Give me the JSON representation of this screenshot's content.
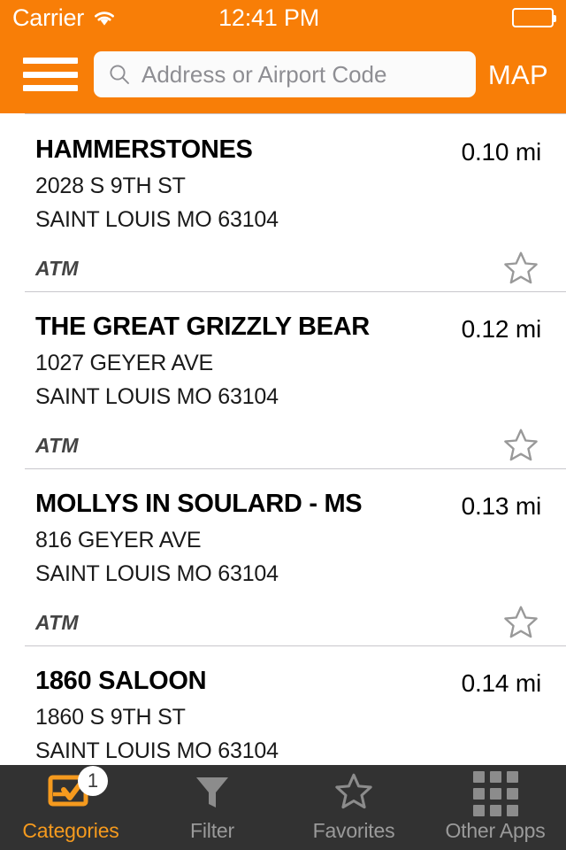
{
  "colors": {
    "brand_orange": "#f87e07",
    "tab_active_orange": "#f59a1e",
    "tab_bar_background": "#323232",
    "tab_inactive_gray": "#9a9a9a",
    "separator_gray": "#c8c7cc",
    "star_outline_gray": "#999999"
  },
  "status_bar": {
    "carrier": "Carrier",
    "wifi_icon": "wifi-icon",
    "time": "12:41 PM",
    "battery_icon": "battery-icon"
  },
  "nav_bar": {
    "menu_icon": "hamburger-menu-icon",
    "search": {
      "icon": "search-icon",
      "value": "",
      "placeholder": "Address or Airport Code"
    },
    "map_label": "MAP"
  },
  "list": {
    "items": [
      {
        "name": "HAMMERSTONES",
        "address_line1": "2028 S 9TH ST",
        "address_line2": "SAINT LOUIS MO 63104",
        "tag": "ATM",
        "distance": "0.10 mi",
        "favorite_icon": "star-outline-icon",
        "favorited": false
      },
      {
        "name": "THE GREAT GRIZZLY BEAR",
        "address_line1": "1027 GEYER AVE",
        "address_line2": "SAINT LOUIS MO 63104",
        "tag": "ATM",
        "distance": "0.12 mi",
        "favorite_icon": "star-outline-icon",
        "favorited": false
      },
      {
        "name": "MOLLYS IN SOULARD - MS",
        "address_line1": "816 GEYER AVE",
        "address_line2": "SAINT LOUIS MO 63104",
        "tag": "ATM",
        "distance": "0.13 mi",
        "favorite_icon": "star-outline-icon",
        "favorited": false
      },
      {
        "name": "1860 SALOON",
        "address_line1": "1860 S 9TH ST",
        "address_line2": "SAINT LOUIS MO 63104",
        "tag": "",
        "distance": "0.14 mi",
        "favorite_icon": "star-outline-icon",
        "favorited": false
      }
    ]
  },
  "tab_bar": {
    "tabs": [
      {
        "label": "Categories",
        "icon": "categories-checklist-icon",
        "active": true,
        "badge": "1"
      },
      {
        "label": "Filter",
        "icon": "funnel-filter-icon",
        "active": false,
        "badge": ""
      },
      {
        "label": "Favorites",
        "icon": "star-outline-icon",
        "active": false,
        "badge": ""
      },
      {
        "label": "Other Apps",
        "icon": "grid-apps-icon",
        "active": false,
        "badge": ""
      }
    ]
  }
}
